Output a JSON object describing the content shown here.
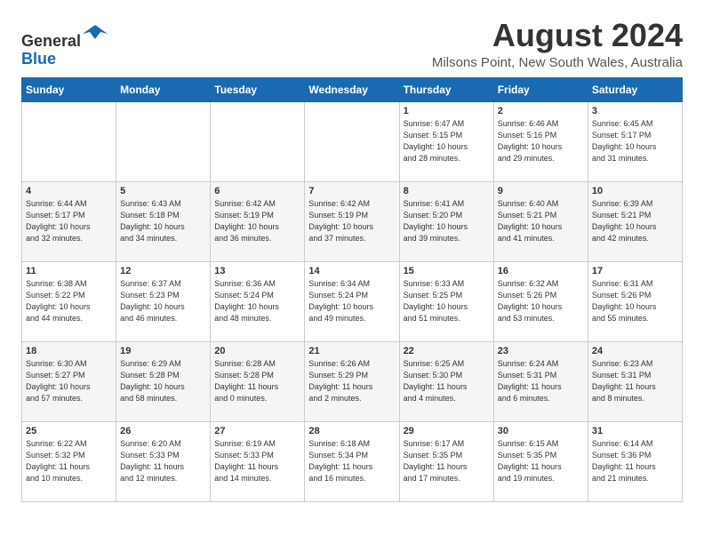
{
  "header": {
    "logo": {
      "line1": "General",
      "line2": "Blue"
    },
    "month_year": "August 2024",
    "location": "Milsons Point, New South Wales, Australia"
  },
  "columns": [
    "Sunday",
    "Monday",
    "Tuesday",
    "Wednesday",
    "Thursday",
    "Friday",
    "Saturday"
  ],
  "weeks": [
    [
      {
        "day": "",
        "info": ""
      },
      {
        "day": "",
        "info": ""
      },
      {
        "day": "",
        "info": ""
      },
      {
        "day": "",
        "info": ""
      },
      {
        "day": "1",
        "info": "Sunrise: 6:47 AM\nSunset: 5:15 PM\nDaylight: 10 hours\nand 28 minutes."
      },
      {
        "day": "2",
        "info": "Sunrise: 6:46 AM\nSunset: 5:16 PM\nDaylight: 10 hours\nand 29 minutes."
      },
      {
        "day": "3",
        "info": "Sunrise: 6:45 AM\nSunset: 5:17 PM\nDaylight: 10 hours\nand 31 minutes."
      }
    ],
    [
      {
        "day": "4",
        "info": "Sunrise: 6:44 AM\nSunset: 5:17 PM\nDaylight: 10 hours\nand 32 minutes."
      },
      {
        "day": "5",
        "info": "Sunrise: 6:43 AM\nSunset: 5:18 PM\nDaylight: 10 hours\nand 34 minutes."
      },
      {
        "day": "6",
        "info": "Sunrise: 6:42 AM\nSunset: 5:19 PM\nDaylight: 10 hours\nand 36 minutes."
      },
      {
        "day": "7",
        "info": "Sunrise: 6:42 AM\nSunset: 5:19 PM\nDaylight: 10 hours\nand 37 minutes."
      },
      {
        "day": "8",
        "info": "Sunrise: 6:41 AM\nSunset: 5:20 PM\nDaylight: 10 hours\nand 39 minutes."
      },
      {
        "day": "9",
        "info": "Sunrise: 6:40 AM\nSunset: 5:21 PM\nDaylight: 10 hours\nand 41 minutes."
      },
      {
        "day": "10",
        "info": "Sunrise: 6:39 AM\nSunset: 5:21 PM\nDaylight: 10 hours\nand 42 minutes."
      }
    ],
    [
      {
        "day": "11",
        "info": "Sunrise: 6:38 AM\nSunset: 5:22 PM\nDaylight: 10 hours\nand 44 minutes."
      },
      {
        "day": "12",
        "info": "Sunrise: 6:37 AM\nSunset: 5:23 PM\nDaylight: 10 hours\nand 46 minutes."
      },
      {
        "day": "13",
        "info": "Sunrise: 6:36 AM\nSunset: 5:24 PM\nDaylight: 10 hours\nand 48 minutes."
      },
      {
        "day": "14",
        "info": "Sunrise: 6:34 AM\nSunset: 5:24 PM\nDaylight: 10 hours\nand 49 minutes."
      },
      {
        "day": "15",
        "info": "Sunrise: 6:33 AM\nSunset: 5:25 PM\nDaylight: 10 hours\nand 51 minutes."
      },
      {
        "day": "16",
        "info": "Sunrise: 6:32 AM\nSunset: 5:26 PM\nDaylight: 10 hours\nand 53 minutes."
      },
      {
        "day": "17",
        "info": "Sunrise: 6:31 AM\nSunset: 5:26 PM\nDaylight: 10 hours\nand 55 minutes."
      }
    ],
    [
      {
        "day": "18",
        "info": "Sunrise: 6:30 AM\nSunset: 5:27 PM\nDaylight: 10 hours\nand 57 minutes."
      },
      {
        "day": "19",
        "info": "Sunrise: 6:29 AM\nSunset: 5:28 PM\nDaylight: 10 hours\nand 58 minutes."
      },
      {
        "day": "20",
        "info": "Sunrise: 6:28 AM\nSunset: 5:28 PM\nDaylight: 11 hours\nand 0 minutes."
      },
      {
        "day": "21",
        "info": "Sunrise: 6:26 AM\nSunset: 5:29 PM\nDaylight: 11 hours\nand 2 minutes."
      },
      {
        "day": "22",
        "info": "Sunrise: 6:25 AM\nSunset: 5:30 PM\nDaylight: 11 hours\nand 4 minutes."
      },
      {
        "day": "23",
        "info": "Sunrise: 6:24 AM\nSunset: 5:31 PM\nDaylight: 11 hours\nand 6 minutes."
      },
      {
        "day": "24",
        "info": "Sunrise: 6:23 AM\nSunset: 5:31 PM\nDaylight: 11 hours\nand 8 minutes."
      }
    ],
    [
      {
        "day": "25",
        "info": "Sunrise: 6:22 AM\nSunset: 5:32 PM\nDaylight: 11 hours\nand 10 minutes."
      },
      {
        "day": "26",
        "info": "Sunrise: 6:20 AM\nSunset: 5:33 PM\nDaylight: 11 hours\nand 12 minutes."
      },
      {
        "day": "27",
        "info": "Sunrise: 6:19 AM\nSunset: 5:33 PM\nDaylight: 11 hours\nand 14 minutes."
      },
      {
        "day": "28",
        "info": "Sunrise: 6:18 AM\nSunset: 5:34 PM\nDaylight: 11 hours\nand 16 minutes."
      },
      {
        "day": "29",
        "info": "Sunrise: 6:17 AM\nSunset: 5:35 PM\nDaylight: 11 hours\nand 17 minutes."
      },
      {
        "day": "30",
        "info": "Sunrise: 6:15 AM\nSunset: 5:35 PM\nDaylight: 11 hours\nand 19 minutes."
      },
      {
        "day": "31",
        "info": "Sunrise: 6:14 AM\nSunset: 5:36 PM\nDaylight: 11 hours\nand 21 minutes."
      }
    ]
  ]
}
